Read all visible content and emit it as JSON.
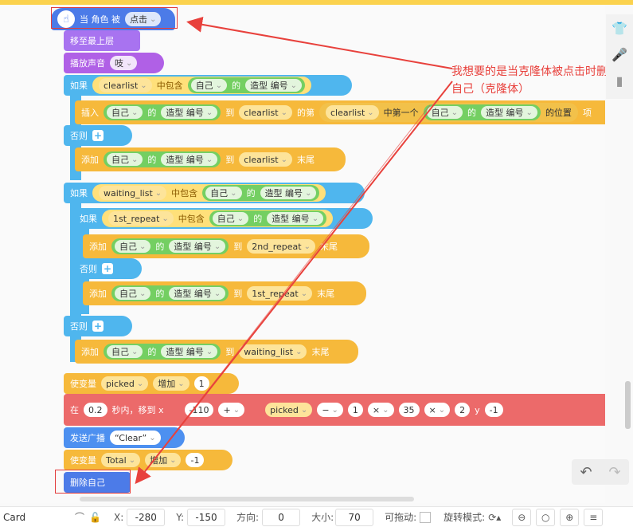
{
  "hat": {
    "label": "当 角色 被",
    "trigger": "点击"
  },
  "front": {
    "label": "移至最上层"
  },
  "sound": {
    "label": "播放声音",
    "value": "吱"
  },
  "if1": {
    "kw": "如果",
    "list": "clearlist",
    "contains": "中包含",
    "self": "自己",
    "of": "的",
    "prop": "造型 编号"
  },
  "insert": {
    "kw": "插入",
    "self": "自己",
    "of": "的",
    "prop": "造型 编号",
    "to": "到",
    "list": "clearlist",
    "pos": "的第",
    "inner_list": "clearlist",
    "first": "中第一个",
    "self2": "自己",
    "of2": "的",
    "prop2": "造型 编号",
    "pos2": "的位置",
    "item": "项"
  },
  "else1": {
    "kw": "否则"
  },
  "add1": {
    "kw": "添加",
    "self": "自己",
    "of": "的",
    "prop": "造型 编号",
    "to": "到",
    "list": "clearlist",
    "end": "末尾"
  },
  "if2": {
    "kw": "如果",
    "list": "waiting_list",
    "contains": "中包含",
    "self": "自己",
    "of": "的",
    "prop": "造型 编号"
  },
  "if3": {
    "kw": "如果",
    "list": "1st_repeat",
    "contains": "中包含",
    "self": "自己",
    "of": "的",
    "prop": "造型 编号"
  },
  "add2": {
    "kw": "添加",
    "self": "自己",
    "of": "的",
    "prop": "造型 编号",
    "to": "到",
    "list": "2nd_repeat",
    "end": "末尾"
  },
  "else3": {
    "kw": "否则"
  },
  "add3": {
    "kw": "添加",
    "self": "自己",
    "of": "的",
    "prop": "造型 编号",
    "to": "到",
    "list": "1st_repeat",
    "end": "末尾"
  },
  "else2": {
    "kw": "否则"
  },
  "add4": {
    "kw": "添加",
    "self": "自己",
    "of": "的",
    "prop": "造型 编号",
    "to": "到",
    "list": "waiting_list",
    "end": "末尾"
  },
  "setvar1": {
    "kw": "使变量",
    "var": "picked",
    "op": "增加",
    "val": "1"
  },
  "glide": {
    "kw": "在",
    "secs": "0.2",
    "mid": "秒内，移到 x",
    "x1": "-110",
    "plus": "+",
    "var": "picked",
    "minus": "−",
    "n1": "1",
    "times": "×",
    "n2": "35",
    "times2": "×",
    "n3": "2",
    "ylabel": "y",
    "yval": "-1"
  },
  "broadcast": {
    "kw": "发送广播",
    "msg": "“Clear”"
  },
  "setvar2": {
    "kw": "使变量",
    "var": "Total",
    "op": "增加",
    "val": "-1"
  },
  "delete": {
    "label": "删除自己"
  },
  "annotation": "我想要的是当克隆体被点击时删除自己（克隆体）",
  "bottom": {
    "sprite": "Card",
    "x_label": "X:",
    "x": "-280",
    "y_label": "Y:",
    "y": "-150",
    "dir_label": "方向:",
    "dir": "0",
    "size_label": "大小:",
    "size": "70",
    "drag_label": "可拖动:",
    "rot_label": "旋转模式:"
  },
  "colors": {
    "events": "#4c7be8",
    "control": "#4fb6ee",
    "data": "#f6b93b",
    "motion": "#ec6a6a",
    "looks": "#a873f0",
    "annotation": "#e8413c"
  },
  "icons": [
    "costume-icon",
    "microphone-icon",
    "chart-icon",
    "undo-icon",
    "redo-icon",
    "lock-icon",
    "rotate-icon",
    "zoom-out-icon",
    "zoom-reset-icon",
    "zoom-in-icon",
    "menu-icon"
  ]
}
